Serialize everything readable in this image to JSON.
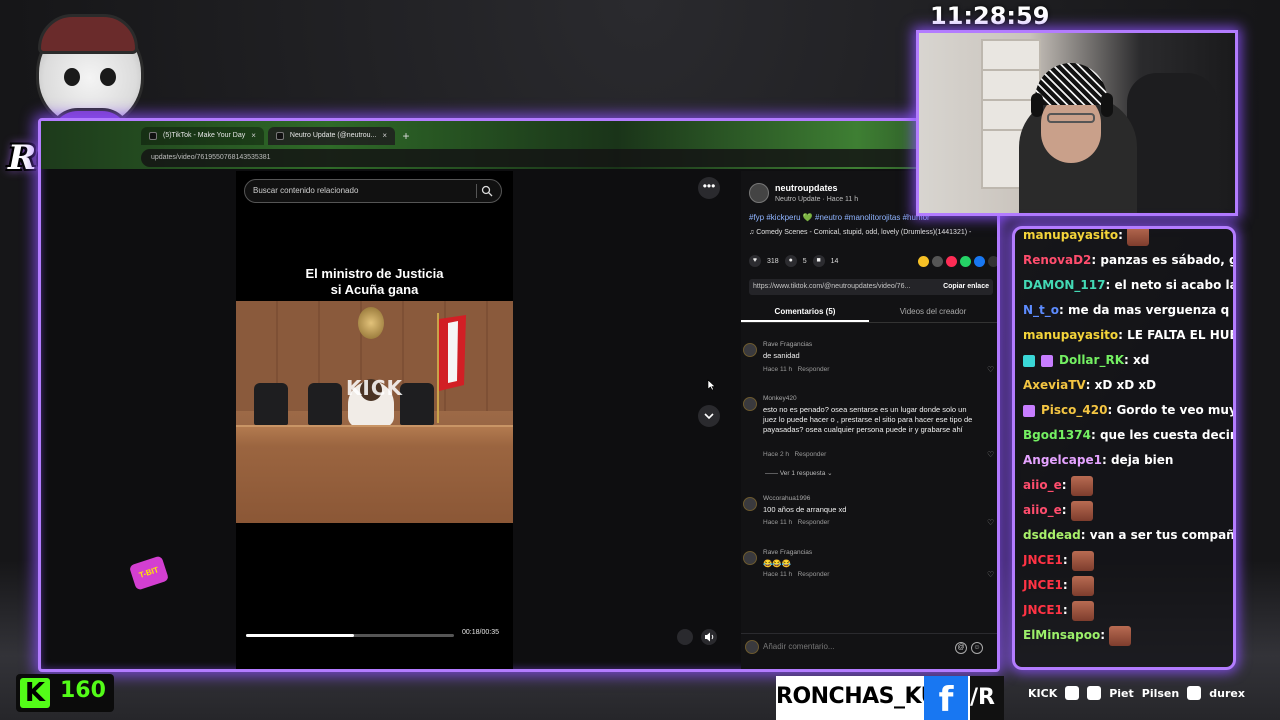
{
  "clock": "11:28:59",
  "logo": {
    "text": "RONCHAS"
  },
  "browser": {
    "tabs": [
      {
        "label": "(5)TikTok - Make Your Day",
        "active": false
      },
      {
        "label": "Neutro Update (@neutrou...",
        "active": true
      }
    ],
    "address": "updates/video/7619550768143535381"
  },
  "video": {
    "search_placeholder": "Buscar contenido relacionado",
    "caption_line1": "El ministro de Justicia",
    "caption_line2": "si Acuña gana",
    "watermark": "KICK",
    "time": "00:18/00:35",
    "progress": 0.52
  },
  "post": {
    "username": "neutroupdates",
    "subtitle": "Neutro Update · Hace 11 h",
    "tags": "#fyp #kickperu 💚 #neutro #manolitorojitas #humor",
    "music": "♫  Comedy Scenes - Comical, stupid, odd, lovely (Drumless)(1441321) -",
    "likes": "318",
    "comments": "5",
    "saves": "14",
    "link": "https://www.tiktok.com/@neutroupdates/video/76...",
    "copy_link": "Copiar enlace",
    "tab_comments": "Comentarios (5)",
    "tab_creator": "Videos del creador",
    "add_comment_placeholder": "Añadir comentario..."
  },
  "comments": [
    {
      "user": "Rave Fragancias",
      "text": "de sanidad",
      "time": "Hace 11 h",
      "reply": "Responder"
    },
    {
      "user": "Monkey420",
      "text": "esto no es penado? osea sentarse es un lugar donde solo un juez lo puede hacer o , prestarse el sitio para hacer ese tipo de payasadas? osea cualquier persona puede ir y grabarse ahí",
      "time": "Hace 2 h",
      "reply": "Responder",
      "replies": "Ver 1 respuesta ⌄"
    },
    {
      "user": "Wccorahua1996",
      "text": "100 años de arranque xd",
      "time": "Hace 11 h",
      "reply": "Responder"
    },
    {
      "user": "Rave Fragancias",
      "text": "😂😂😂",
      "time": "Hace 11 h",
      "reply": "Responder"
    }
  ],
  "chat": [
    {
      "user": "manupayasito",
      "sep": ":",
      "text": "",
      "color": "#f4d43a",
      "emote": true
    },
    {
      "user": "RenovaD2",
      "sep": ":",
      "text": " panzas es sábado, go b",
      "color": "#ff4d6d"
    },
    {
      "user": "DAMON_117",
      "sep": ":",
      "text": " el neto si acabo la sec",
      "color": "#43d9b5"
    },
    {
      "user": "N_t_o",
      "sep": ":",
      "text": " me da mas verguenza q risa",
      "color": "#5d8cff"
    },
    {
      "user": "manupayasito",
      "sep": ":",
      "text": " LE FALTA EL HUESO",
      "color": "#f4d43a"
    },
    {
      "user": "Dollar_RK",
      "sep": ":",
      "text": " xd",
      "color": "#74f062",
      "badges": 2
    },
    {
      "user": "AxeviaTV",
      "sep": ":",
      "text": " xD xD xD",
      "color": "#f4c542"
    },
    {
      "user": "Pisco_420",
      "sep": ":",
      "text": " Gordo te veo muy ex",
      "color": "#f4c542",
      "badges": 1
    },
    {
      "user": "Bgod1374",
      "sep": ":",
      "text": " que les cuesta decir no",
      "color": "#74f062"
    },
    {
      "user": "Angelcape1",
      "sep": ":",
      "text": " deja bien",
      "color": "#e5a3ff"
    },
    {
      "user": "aiio_e",
      "sep": ":",
      "text": "",
      "color": "#ff4d6d",
      "emote": true
    },
    {
      "user": "aiio_e",
      "sep": ":",
      "text": "",
      "color": "#ff4d6d",
      "emote": true
    },
    {
      "user": "dsddead",
      "sep": ":",
      "text": " van a ser tus compañero",
      "color": "#a8f06a"
    },
    {
      "user": "JNCE1",
      "sep": ":",
      "text": "",
      "color": "#ff3344",
      "emote": true
    },
    {
      "user": "JNCE1",
      "sep": ":",
      "text": "",
      "color": "#ff3344",
      "emote": true
    },
    {
      "user": "JNCE1",
      "sep": ":",
      "text": "",
      "color": "#ff3344",
      "emote": true
    },
    {
      "user": "ElMinsapoo",
      "sep": ":",
      "text": "",
      "color": "#9cf06a",
      "emote": true
    }
  ],
  "viewers": {
    "logo": "K",
    "count": "160"
  },
  "social": {
    "name": "RONCHAS_KUN",
    "fb": "f",
    "r": "/R"
  },
  "sponsors": [
    "KICK",
    "Piet",
    "Pilsen",
    "durex"
  ],
  "sticker": "T-BIT"
}
